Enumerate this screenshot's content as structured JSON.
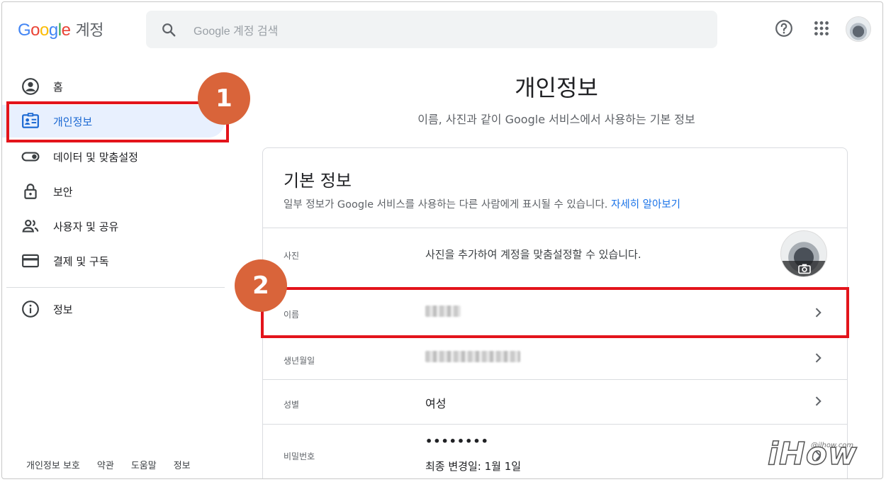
{
  "header": {
    "logo_letters": [
      "G",
      "o",
      "o",
      "g",
      "l",
      "e"
    ],
    "product": "계정",
    "search_placeholder": "Google 계정 검색"
  },
  "sidebar": {
    "items": [
      {
        "label": "홈",
        "icon": "account-circle-icon"
      },
      {
        "label": "개인정보",
        "icon": "id-card-icon",
        "active": true
      },
      {
        "label": "데이터 및 맞춤설정",
        "icon": "toggle-icon"
      },
      {
        "label": "보안",
        "icon": "lock-icon"
      },
      {
        "label": "사용자 및 공유",
        "icon": "people-icon"
      },
      {
        "label": "결제 및 구독",
        "icon": "credit-card-icon"
      },
      {
        "label": "정보",
        "icon": "info-icon"
      }
    ],
    "footer": [
      "개인정보 보호",
      "약관",
      "도움말",
      "정보"
    ]
  },
  "main": {
    "title": "개인정보",
    "subtitle": "이름, 사진과 같이 Google 서비스에서 사용하는 기본 정보",
    "card": {
      "title": "기본 정보",
      "desc": "일부 정보가 Google 서비스를 사용하는 다른 사람에게 표시될 수 있습니다. ",
      "learn_more": "자세히 알아보기",
      "rows": [
        {
          "label": "사진",
          "value": "사진을 추가하여 계정을 맞춤설정할 수 있습니다."
        },
        {
          "label": "이름",
          "value": ""
        },
        {
          "label": "생년월일",
          "value": ""
        },
        {
          "label": "성별",
          "value": "여성"
        },
        {
          "label": "비밀번호",
          "value": "••••••••",
          "sub": "최종 변경일: 1월 1일"
        }
      ]
    }
  },
  "annotations": {
    "badge1": "1",
    "badge2": "2",
    "highlight_color": "#e3141b",
    "badge_color": "#d9643a"
  },
  "watermark": {
    "text": "iHow",
    "url": "@ilhow.com"
  }
}
